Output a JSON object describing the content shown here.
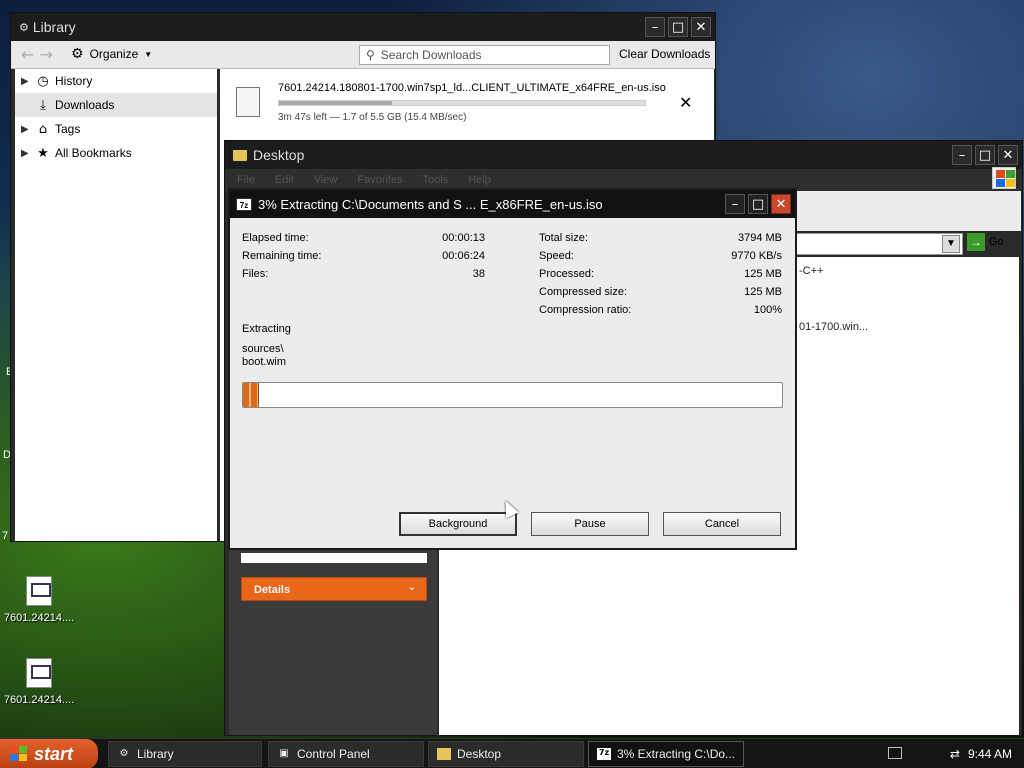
{
  "desktop": {
    "icons": [
      {
        "label": "7601.24214...."
      },
      {
        "label": "7601.24214...."
      }
    ],
    "edge_letters": [
      "E",
      "D",
      "7"
    ]
  },
  "library": {
    "title": "Library",
    "organize_label": "Organize",
    "search_placeholder": "Search Downloads",
    "clear_label": "Clear Downloads",
    "sidebar": [
      {
        "label": "History",
        "icon": "clock-icon",
        "expandable": true
      },
      {
        "label": "Downloads",
        "icon": "download-icon",
        "expandable": false,
        "selected": true
      },
      {
        "label": "Tags",
        "icon": "tag-icon",
        "expandable": true
      },
      {
        "label": "All Bookmarks",
        "icon": "star-icon",
        "expandable": true
      }
    ],
    "download": {
      "filename": "7601.24214.180801-1700.win7sp1_ld...CLIENT_ULTIMATE_x64FRE_en-us.iso",
      "status": "3m 47s left — 1.7 of 5.5 GB (15.4 MB/sec)",
      "progress_fraction": 0.31
    }
  },
  "explorer": {
    "title": "Desktop",
    "menu": [
      "File",
      "Edit",
      "View",
      "Favorites",
      "Tools",
      "Help"
    ],
    "go_label": "Go",
    "details_label": "Details",
    "list_fragments": [
      "-C++",
      "01-1700.win..."
    ]
  },
  "extract_dialog": {
    "title": "3% Extracting C:\\Documents and S ... E_x86FRE_en-us.iso",
    "left_stats": [
      {
        "label": "Elapsed time:",
        "value": "00:00:13"
      },
      {
        "label": "Remaining time:",
        "value": "00:06:24"
      },
      {
        "label": "Files:",
        "value": "38"
      }
    ],
    "right_stats": [
      {
        "label": "Total size:",
        "value": "3794 MB"
      },
      {
        "label": "Speed:",
        "value": "9770 KB/s"
      },
      {
        "label": "Processed:",
        "value": "125 MB"
      },
      {
        "label": "Compressed size:",
        "value": "125 MB"
      },
      {
        "label": "Compression ratio:",
        "value": "100%"
      }
    ],
    "extracting_label": "Extracting",
    "current_path": "sources\\",
    "current_file": "boot.wim",
    "progress_fraction": 0.03,
    "buttons": {
      "background": "Background",
      "pause": "Pause",
      "cancel": "Cancel"
    }
  },
  "taskbar": {
    "start_label": "start",
    "tasks": [
      {
        "label": "Library",
        "icon": "library-icon"
      },
      {
        "label": "Control Panel",
        "icon": "control-panel-icon"
      },
      {
        "label": "Desktop",
        "icon": "folder-icon"
      },
      {
        "label": "3% Extracting C:\\Do...",
        "icon": "7zip-icon",
        "active": true
      }
    ],
    "clock": "9:44 AM"
  }
}
